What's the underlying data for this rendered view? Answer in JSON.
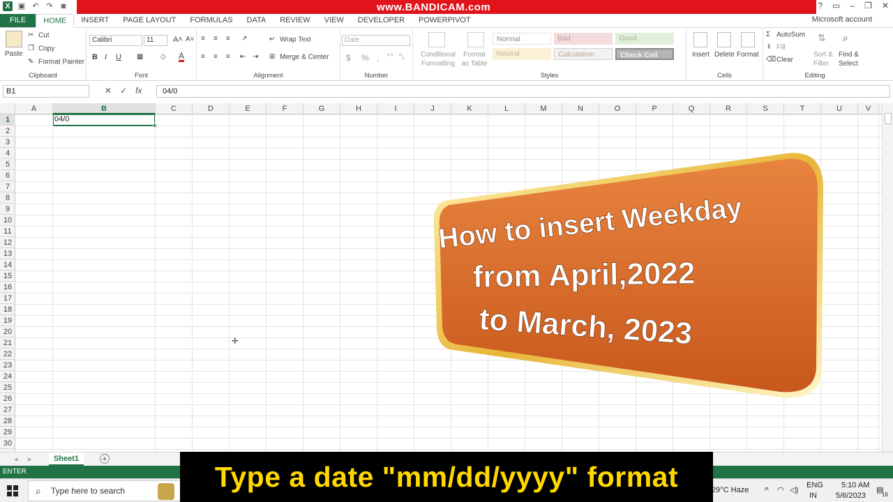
{
  "window": {
    "watermark": "www.BANDICAM.com",
    "account": "Microsoft account"
  },
  "tabs": [
    "FILE",
    "HOME",
    "INSERT",
    "PAGE LAYOUT",
    "FORMULAS",
    "DATA",
    "REVIEW",
    "VIEW",
    "DEVELOPER",
    "POWERPIVOT"
  ],
  "ribbon": {
    "clipboard": {
      "paste": "Paste",
      "cut": "Cut",
      "copy": "Copy",
      "format_painter": "Format Painter",
      "label": "Clipboard"
    },
    "font": {
      "name": "Calibri",
      "size": "11",
      "label": "Font"
    },
    "alignment": {
      "wrap": "Wrap Text",
      "merge": "Merge & Center",
      "label": "Alignment"
    },
    "number": {
      "format": "Date",
      "label": "Number"
    },
    "styles": {
      "conditional": "Conditional Formatting",
      "format_table": "Format as Table",
      "cells": [
        "Normal",
        "Bad",
        "Good",
        "Neutral",
        "Calculation",
        "Check Cell"
      ],
      "label": "Styles"
    },
    "cells": {
      "insert": "Insert",
      "delete": "Delete",
      "format": "Format",
      "label": "Cells"
    },
    "editing": {
      "autosum": "AutoSum",
      "fill": "Fill",
      "clear": "Clear",
      "sort": "Sort & Filter",
      "find": "Find & Select",
      "label": "Editing"
    }
  },
  "formula_bar": {
    "name_box": "B1",
    "formula": "04/0"
  },
  "grid": {
    "columns": [
      "A",
      "B",
      "C",
      "D",
      "E",
      "F",
      "G",
      "H",
      "I",
      "J",
      "K",
      "L",
      "M",
      "N",
      "O",
      "P",
      "Q",
      "R",
      "S",
      "T",
      "U",
      "V"
    ],
    "rows": [
      "1",
      "2",
      "3",
      "4",
      "5",
      "6",
      "7",
      "8",
      "9",
      "10",
      "11",
      "12",
      "13",
      "14",
      "15",
      "16",
      "17",
      "18",
      "19",
      "20",
      "21",
      "22",
      "23",
      "24",
      "25",
      "26",
      "27",
      "28",
      "29",
      "30"
    ],
    "active_cell_value": "04/0"
  },
  "sheets": [
    "Sheet1"
  ],
  "status": {
    "mode": "ENTER"
  },
  "taskbar": {
    "search_placeholder": "Type here to search",
    "weather": "29°C  Haze",
    "lang": "ENG",
    "region": "IN",
    "time": "5:10 AM",
    "date": "5/6/2023",
    "notifications": "16"
  },
  "banner": {
    "line1": "How to insert Weekday",
    "line2": "from April,2022",
    "line3": "to March, 2023"
  },
  "caption": "Type a date \"mm/dd/yyyy\" format",
  "colors": {
    "excel_green": "#217346",
    "banner_orange": "#d9692a",
    "caption_yellow": "#ffd800",
    "bandicam_red": "#e0141a"
  }
}
